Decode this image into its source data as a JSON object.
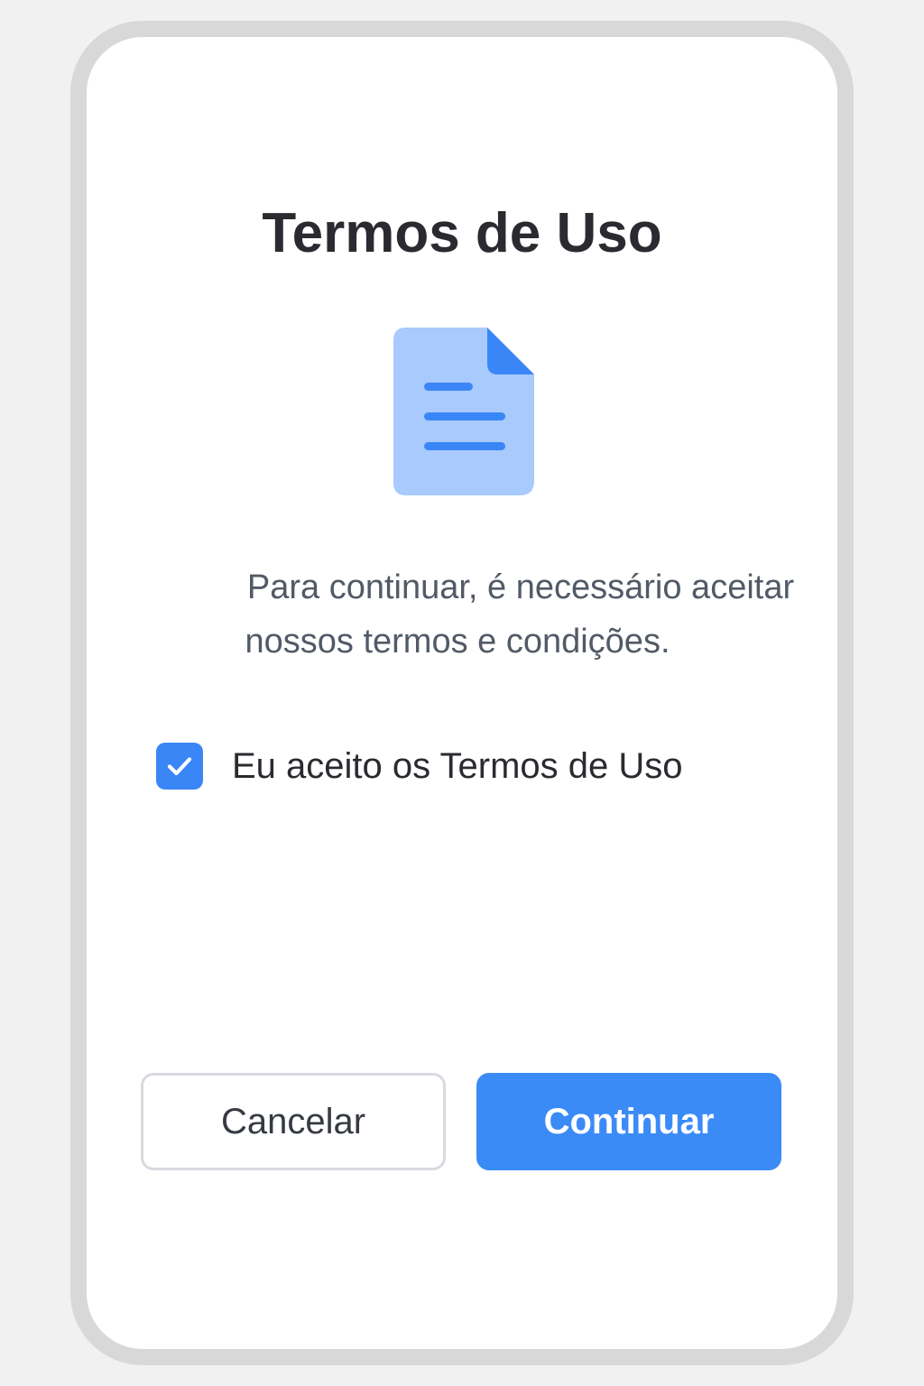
{
  "dialog": {
    "title": "Termos de Uso",
    "icon": "document-icon",
    "description_line1": "Para continuar, é necessário aceitar",
    "description_line2": "nossos termos e condições.",
    "checkbox": {
      "label": "Eu aceito os Termos de Uso",
      "checked": true,
      "icon": "checkmark-icon"
    },
    "buttons": {
      "cancel_label": "Cancelar",
      "continue_label": "Continuar"
    }
  },
  "colors": {
    "accent": "#3b8bf7",
    "icon_light": "#a8cafc",
    "title_text": "#2a2b30",
    "body_text": "#525a67",
    "frame": "#d8d8d8",
    "background": "#f1f1f1"
  }
}
